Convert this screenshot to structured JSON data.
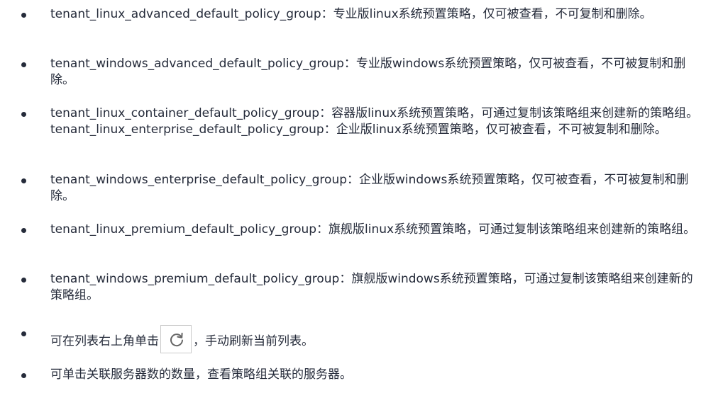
{
  "items": [
    {
      "text": "tenant_linux_advanced_default_policy_group：专业版linux系统预置策略，仅可被查看，不可复制和删除。"
    },
    {
      "text": "tenant_windows_advanced_default_policy_group：专业版windows系统预置策略，仅可被查看，不可被复制和删除。"
    },
    {
      "text": "tenant_linux_container_default_policy_group：容器版linux系统预置策略，可通过复制该策略组来创建新的策略组。tenant_linux_enterprise_default_policy_group：企业版linux系统预置策略，仅可被查看，不可被复制和删除。"
    },
    {
      "text": "tenant_windows_enterprise_default_policy_group：企业版windows系统预置策略，仅可被查看，不可被复制和删除。"
    },
    {
      "text": "tenant_linux_premium_default_policy_group：旗舰版linux系统预置策略，可通过复制该策略组来创建新的策略组。"
    },
    {
      "text": "tenant_windows_premium_default_policy_group：旗舰版windows系统预置策略，可通过复制该策略组来创建新的策略组。"
    },
    {
      "text_before": "可在列表右上角单击",
      "icon": "refresh-icon",
      "text_after": "，手动刷新当前列表。"
    },
    {
      "text": "可单击关联服务器数的数量，查看策略组关联的服务器。"
    }
  ],
  "colors": {
    "text": "#252b3a",
    "icon": "#666666",
    "button_border": "#c9c9c9"
  }
}
